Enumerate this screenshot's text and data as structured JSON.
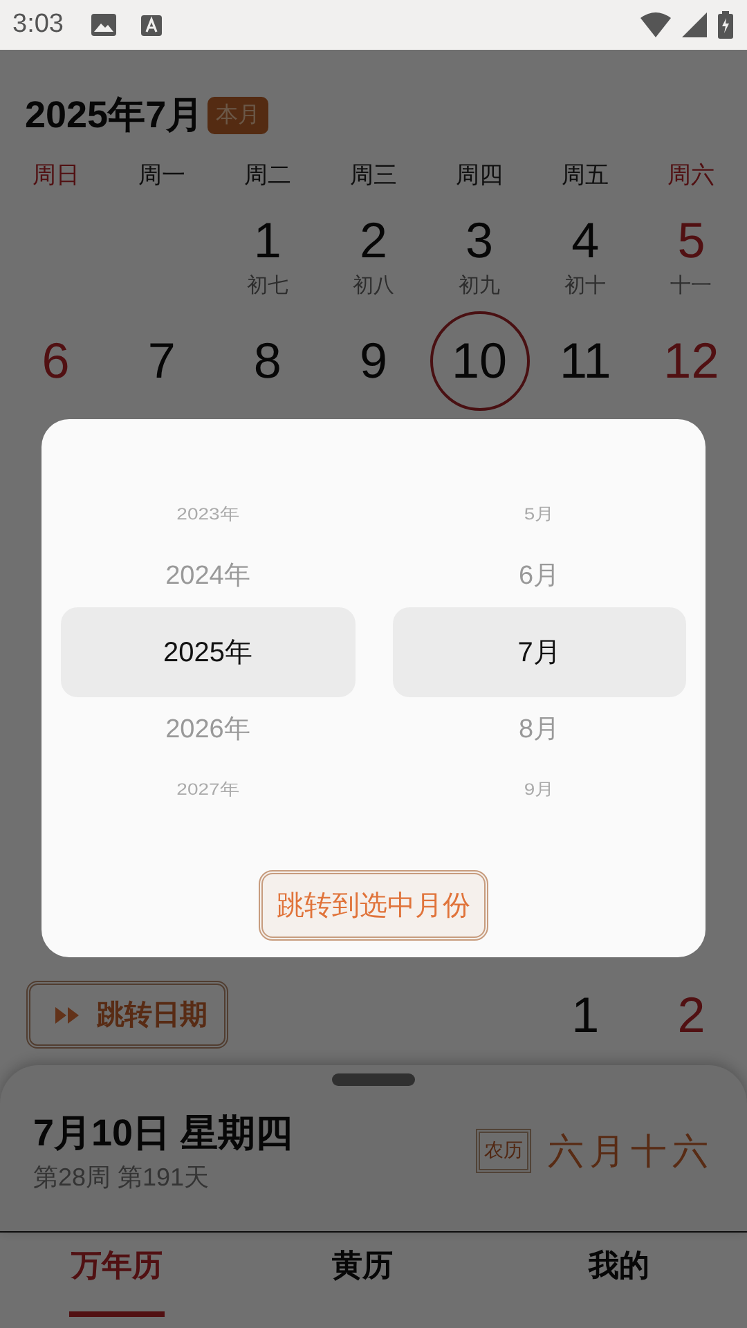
{
  "status_bar": {
    "time": "3:03"
  },
  "calendar": {
    "title": "2025年7月",
    "badge": "本月",
    "weekdays": [
      {
        "label": "周日",
        "weekend": true
      },
      {
        "label": "周一",
        "weekend": false
      },
      {
        "label": "周二",
        "weekend": false
      },
      {
        "label": "周三",
        "weekend": false
      },
      {
        "label": "周四",
        "weekend": false
      },
      {
        "label": "周五",
        "weekend": false
      },
      {
        "label": "周六",
        "weekend": true
      }
    ],
    "weeks": [
      [
        {
          "kind": "empty"
        },
        {
          "kind": "empty"
        },
        {
          "kind": "day",
          "day": "1",
          "lunar": "初七",
          "weekend": false,
          "today": false
        },
        {
          "kind": "day",
          "day": "2",
          "lunar": "初八",
          "weekend": false,
          "today": false
        },
        {
          "kind": "day",
          "day": "3",
          "lunar": "初九",
          "weekend": false,
          "today": false
        },
        {
          "kind": "day",
          "day": "4",
          "lunar": "初十",
          "weekend": false,
          "today": false
        },
        {
          "kind": "day",
          "day": "5",
          "lunar": "十一",
          "weekend": true,
          "today": false
        }
      ],
      [
        {
          "kind": "day",
          "day": "6",
          "weekend": true,
          "today": false
        },
        {
          "kind": "day",
          "day": "7",
          "weekend": false,
          "today": false
        },
        {
          "kind": "day",
          "day": "8",
          "weekend": false,
          "today": false
        },
        {
          "kind": "day",
          "day": "9",
          "weekend": false,
          "today": false
        },
        {
          "kind": "day",
          "day": "10",
          "weekend": false,
          "today": true
        },
        {
          "kind": "day",
          "day": "11",
          "weekend": false,
          "today": false
        },
        {
          "kind": "day",
          "day": "12",
          "weekend": true,
          "today": false
        }
      ]
    ],
    "jump_button": "跳转日期",
    "next_month_days": [
      {
        "kind": "empty"
      },
      {
        "kind": "empty"
      },
      {
        "kind": "day",
        "day": "1",
        "weekend": false
      },
      {
        "kind": "day",
        "day": "2",
        "weekend": true
      }
    ]
  },
  "selected_day": {
    "date": "7月10日 星期四",
    "info": "第28周 第191天",
    "lunar_badge": "农历",
    "lunar_date": "六月十六"
  },
  "tabs": [
    {
      "label": "万年历",
      "selected": true
    },
    {
      "label": "黄历",
      "selected": false
    },
    {
      "label": "我的",
      "selected": false
    }
  ],
  "dialog": {
    "years": [
      {
        "label": "2023年",
        "selected": false
      },
      {
        "label": "2024年",
        "selected": false
      },
      {
        "label": "2025年",
        "selected": true
      },
      {
        "label": "2026年",
        "selected": false
      },
      {
        "label": "2027年",
        "selected": false
      }
    ],
    "months": [
      {
        "label": "5月",
        "selected": false
      },
      {
        "label": "6月",
        "selected": false
      },
      {
        "label": "7月",
        "selected": true
      },
      {
        "label": "8月",
        "selected": false
      },
      {
        "label": "9月",
        "selected": false
      }
    ],
    "confirm_button": "跳转到选中月份"
  }
}
